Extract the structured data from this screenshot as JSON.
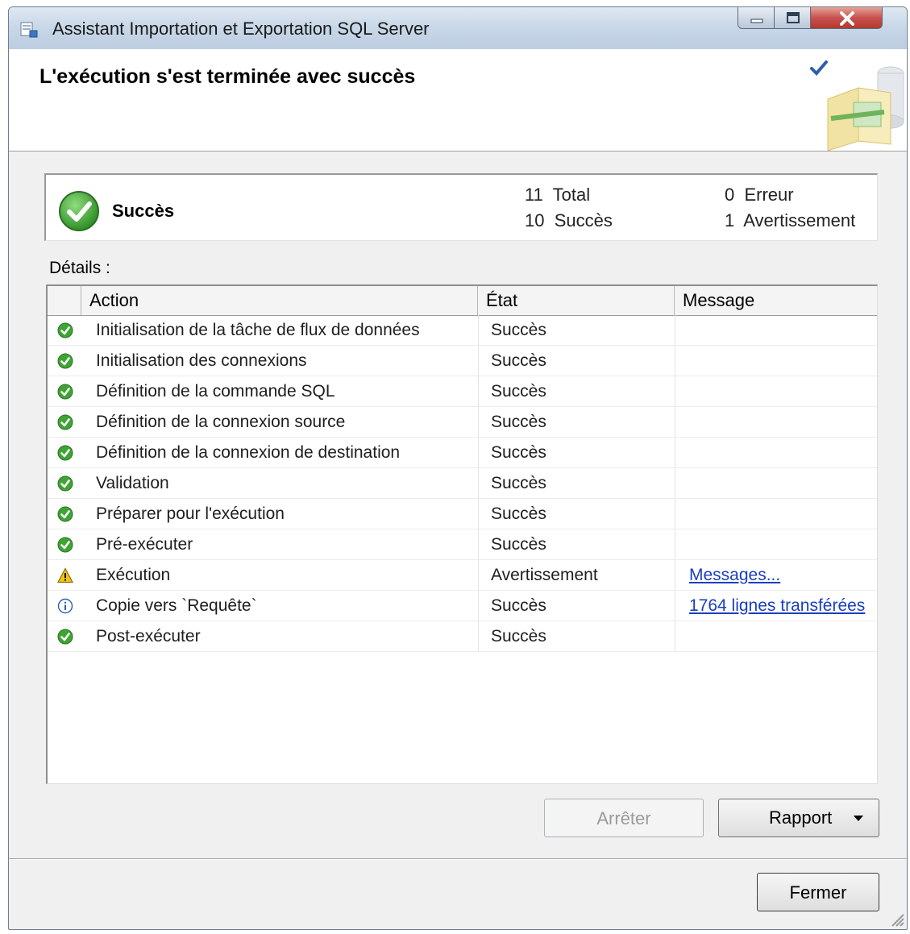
{
  "window": {
    "title": "Assistant Importation et Exportation SQL Server"
  },
  "header": {
    "title": "L'exécution s'est terminée avec succès"
  },
  "summary": {
    "status": "Succès",
    "total_count": "11",
    "total_label": "Total",
    "success_count": "10",
    "success_label": "Succès",
    "error_count": "0",
    "error_label": "Erreur",
    "warning_count": "1",
    "warning_label": "Avertissement"
  },
  "details": {
    "label": "Détails :",
    "columns": [
      "Action",
      "État",
      "Message"
    ],
    "rows": [
      {
        "icon": "success-icon",
        "action": "Initialisation de la tâche de flux de données",
        "state": "Succès",
        "message": ""
      },
      {
        "icon": "success-icon",
        "action": "Initialisation des connexions",
        "state": "Succès",
        "message": ""
      },
      {
        "icon": "success-icon",
        "action": "Définition de la commande SQL",
        "state": "Succès",
        "message": ""
      },
      {
        "icon": "success-icon",
        "action": "Définition de la connexion source",
        "state": "Succès",
        "message": ""
      },
      {
        "icon": "success-icon",
        "action": "Définition de la connexion de destination",
        "state": "Succès",
        "message": ""
      },
      {
        "icon": "success-icon",
        "action": "Validation",
        "state": "Succès",
        "message": ""
      },
      {
        "icon": "success-icon",
        "action": "Préparer pour l'exécution",
        "state": "Succès",
        "message": ""
      },
      {
        "icon": "success-icon",
        "action": "Pré-exécuter",
        "state": "Succès",
        "message": ""
      },
      {
        "icon": "warning-icon",
        "action": "Exécution",
        "state": "Avertissement",
        "message": "Messages..."
      },
      {
        "icon": "info-icon",
        "action": "Copie vers `Requête`",
        "state": "Succès",
        "message": "1764 lignes transférées"
      },
      {
        "icon": "success-icon",
        "action": "Post-exécuter",
        "state": "Succès",
        "message": ""
      }
    ]
  },
  "buttons": {
    "stop": "Arrêter",
    "report": "Rapport",
    "close": "Fermer"
  },
  "colors": {
    "success": "#3ea434",
    "warning": "#f0c419",
    "info": "#2f5fb3",
    "link": "#1a3fbf"
  }
}
